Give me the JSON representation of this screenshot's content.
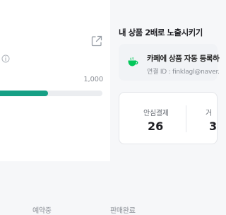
{
  "colors": {
    "accent": "#16a085",
    "track": "#ebedf0",
    "naver_green": "#03c75a"
  },
  "progress": {
    "max_label": "1,000",
    "fraction": 0.47
  },
  "expose_panel": {
    "title": "내 상품 2배로 노출시키기",
    "cafe_title": "카페에 상품 자동 등록하",
    "cafe_id_line": "연결 ID : finklagl@naver."
  },
  "stats": [
    {
      "label": "안심결제",
      "value": "26"
    },
    {
      "label": "거",
      "value": "3"
    }
  ],
  "tabs": [
    {
      "label": "예약중"
    },
    {
      "label": "판매완료"
    }
  ],
  "icons": {
    "external_link": "external-link-icon",
    "info": "info-icon",
    "cafe": "cafe-cup-icon"
  }
}
